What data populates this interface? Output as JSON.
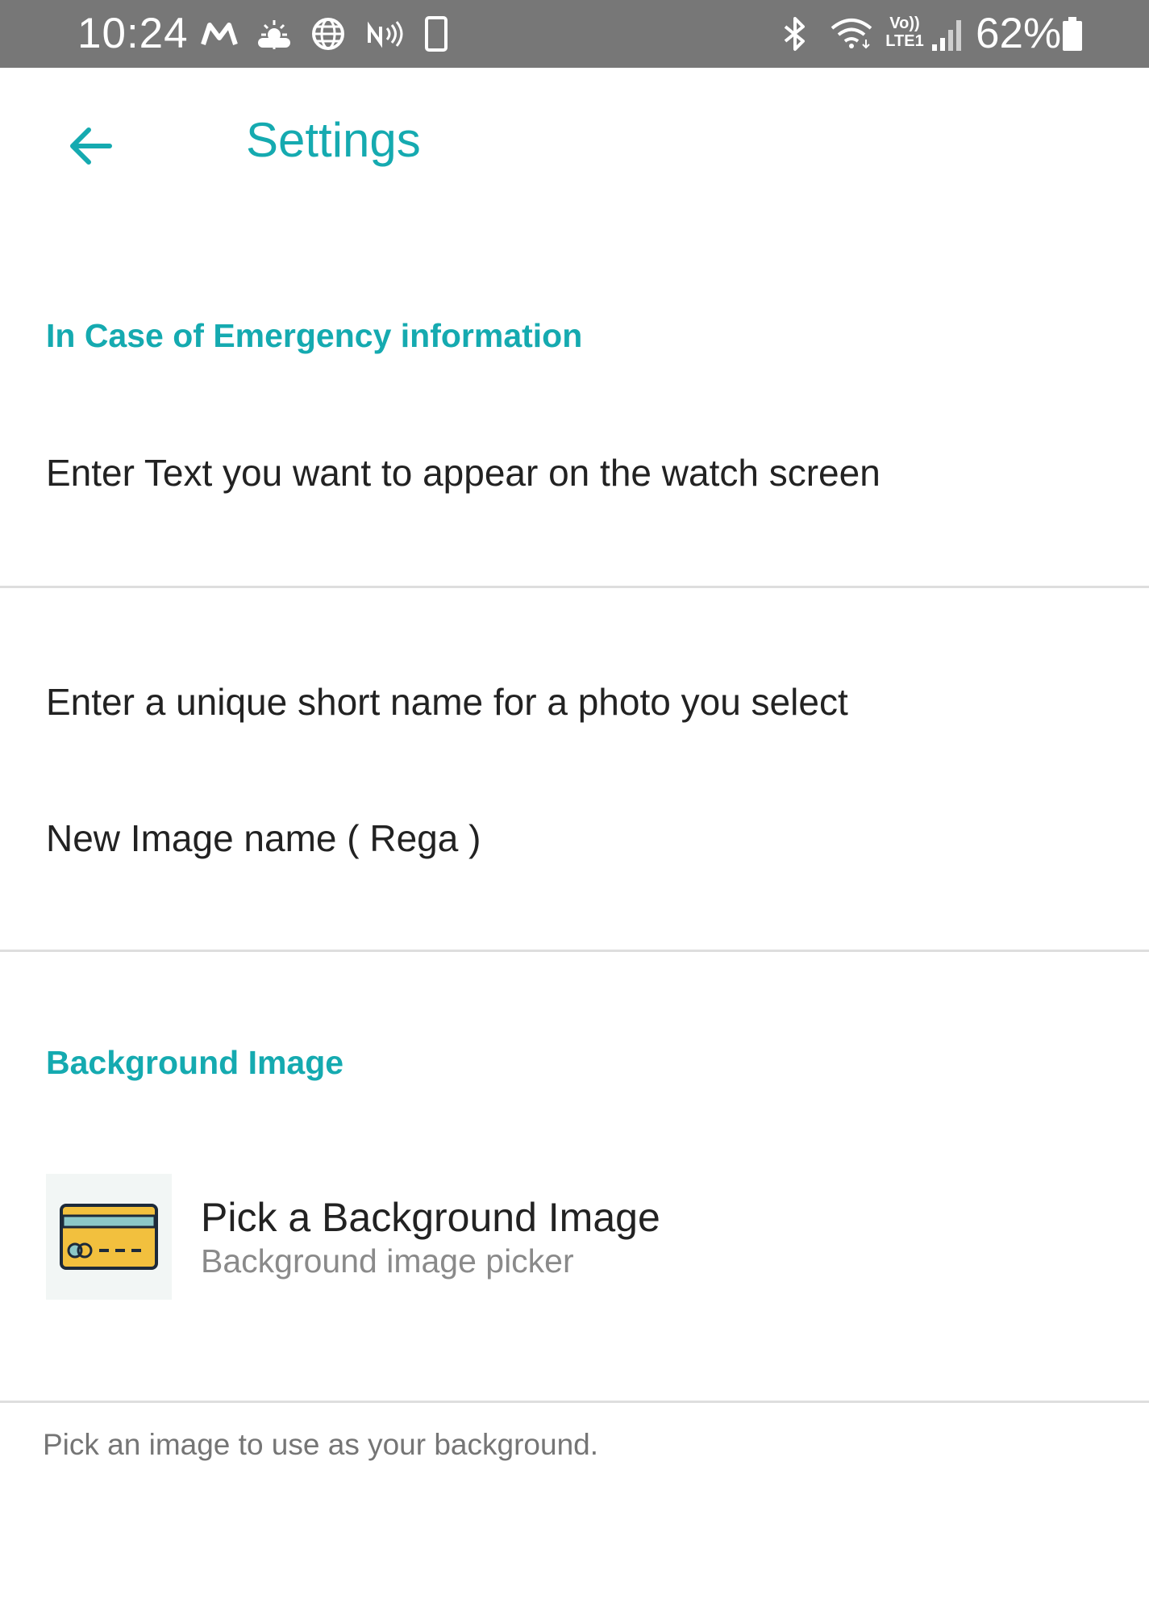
{
  "status_bar": {
    "time": "10:24",
    "battery_percent": "62%",
    "icons": [
      "gmail-icon",
      "weather-icon",
      "globe-icon",
      "nfc-icon",
      "phone-outline-icon",
      "bluetooth-icon",
      "wifi-icon",
      "volte-icon",
      "signal-icon",
      "battery-icon"
    ],
    "volte_line1": "Vo))",
    "volte_line2": "LTE1"
  },
  "app_bar": {
    "title": "Settings",
    "back_icon": "arrow-left-icon"
  },
  "sections": {
    "emergency": {
      "header": "In Case of Emergency information",
      "text_row": "Enter Text you want to appear on the watch screen"
    },
    "image_name": {
      "prompt": "Enter a unique short name for a photo you select",
      "value_row": "New Image name ( Rega )"
    },
    "background": {
      "header": "Background Image",
      "picker_title": "Pick a Background Image",
      "picker_subtitle": "Background image picker",
      "picker_icon": "credit-card-icon",
      "description": "Pick an image to use as your background."
    }
  },
  "colors": {
    "accent": "#15aab0",
    "status_bar_bg": "#777777",
    "divider": "#dedede",
    "text_primary": "#222222",
    "text_secondary": "#8a8a8a"
  }
}
